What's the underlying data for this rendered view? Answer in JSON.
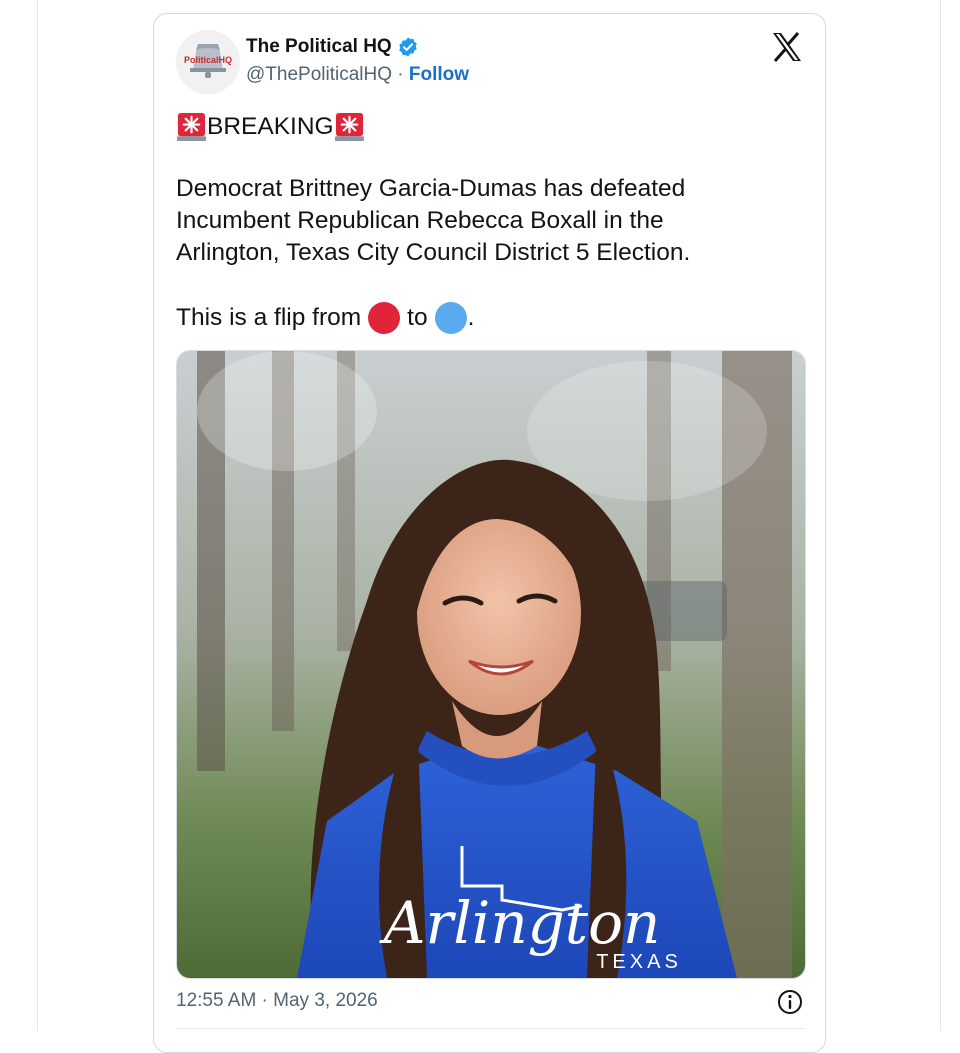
{
  "tweet": {
    "author": {
      "name": "The Political HQ",
      "handle": "@ThePoliticalHQ",
      "separator": "·",
      "follow_label": "Follow",
      "avatar_text": "PoliticalHQ",
      "verified_icon": "verified-badge-icon"
    },
    "platform_icon": "x-logo-icon",
    "breaking": "BREAKING",
    "body_lines": [
      "Democrat Brittney Garcia-Dumas has defeated",
      "Incumbent Republican Rebecca Boxall in the",
      "Arlington, Texas City Council District 5 Election."
    ],
    "flip": {
      "before": "This is a flip from",
      "middle": "to",
      "after": ".",
      "from_color": "#e0253b",
      "to_color": "#5aaaf0"
    },
    "media": {
      "hoodie_text": "Arlington",
      "hoodie_subtext": "TEXAS"
    },
    "timestamp": "12:55 AM · May 3, 2026",
    "info_icon": "info-icon"
  },
  "colors": {
    "text": "#0f1419",
    "muted": "#536471",
    "link": "#1d6fc8",
    "border": "#cfd9de"
  }
}
